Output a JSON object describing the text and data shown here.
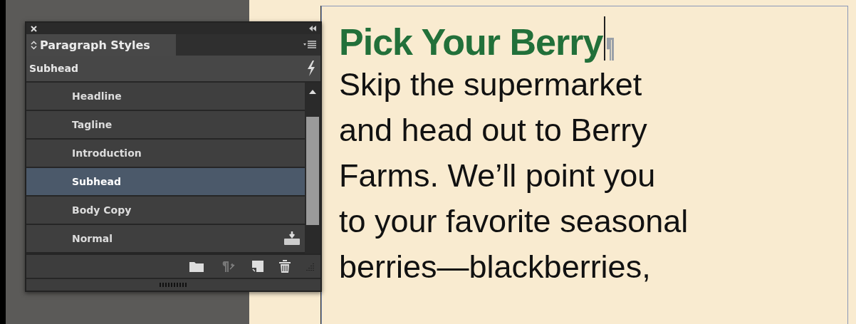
{
  "panel": {
    "title": "Paragraph Styles",
    "current_style": "Subhead",
    "styles": [
      {
        "label": "Headline",
        "selected": false
      },
      {
        "label": "Tagline",
        "selected": false
      },
      {
        "label": "Introduction",
        "selected": false
      },
      {
        "label": "Subhead",
        "selected": true
      },
      {
        "label": "Body Copy",
        "selected": false
      },
      {
        "label": "Normal",
        "selected": false
      }
    ]
  },
  "document": {
    "headline": "Pick Your Berry",
    "body_lines": [
      "Skip the supermarket",
      "and head out to Berry",
      "Farms. We’ll point you",
      "to your favorite seasonal",
      "berries—blackberries,"
    ]
  }
}
